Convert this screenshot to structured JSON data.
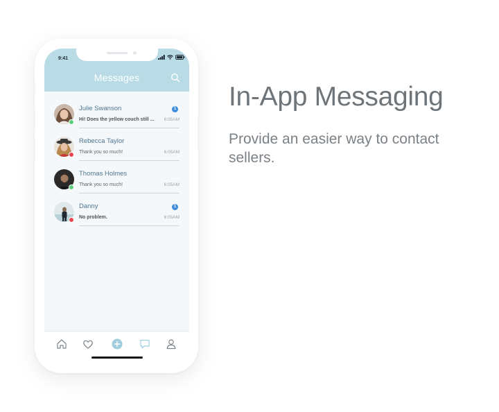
{
  "status": {
    "time": "9:41"
  },
  "header": {
    "title": "Messages"
  },
  "conversations": [
    {
      "name": "Julie Swanson",
      "preview": "Hi! Does the yellow couch still ...",
      "time": "6:05AM",
      "unread": "1",
      "bold": true,
      "online": "green",
      "avatar": "avatar-julie"
    },
    {
      "name": "Rebecca Taylor",
      "preview": "Thank you so much!",
      "time": "6:05AM",
      "unread": null,
      "bold": false,
      "online": "red",
      "avatar": "avatar-rebecca"
    },
    {
      "name": "Thomas Holmes",
      "preview": "Thank you so much!",
      "time": "6:05AM",
      "unread": null,
      "bold": false,
      "online": "green",
      "avatar": "avatar-thomas"
    },
    {
      "name": "Danny",
      "preview": "No problem.",
      "time": "6:05AM",
      "unread": "1",
      "bold": true,
      "online": "red",
      "avatar": "avatar-danny"
    }
  ],
  "tabbar": [
    "home-icon",
    "heart-icon",
    "plus-icon",
    "chat-icon",
    "profile-icon"
  ],
  "hero": {
    "title": "In-App Messaging",
    "subtitle": "Provide an easier way to contact sellers."
  },
  "colors": {
    "header": "#b9dbe6",
    "badge": "#3e8ce0",
    "online": "#5ccf7a",
    "busy": "#e8454f",
    "accent": "#9fcddc"
  }
}
